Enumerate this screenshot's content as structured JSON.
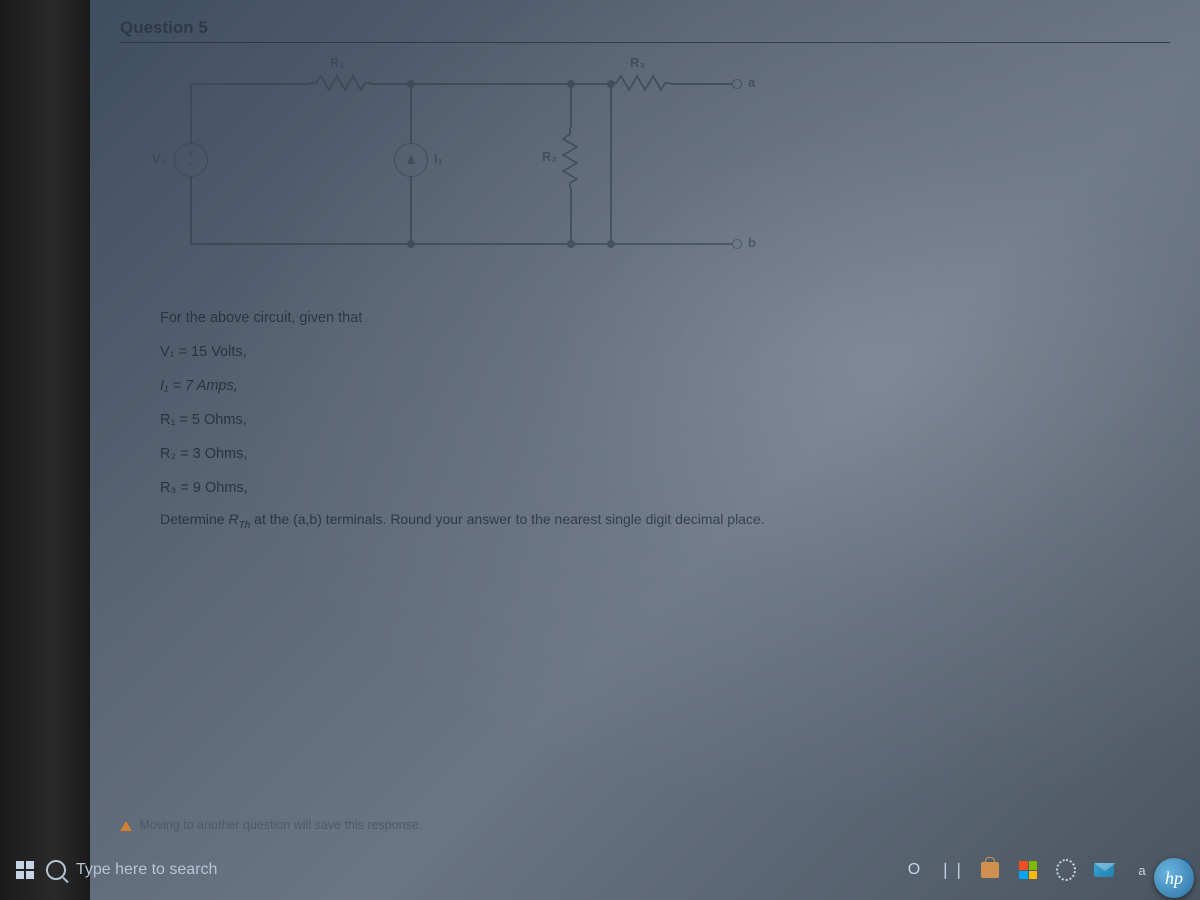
{
  "question": {
    "heading": "Question 5"
  },
  "circuit": {
    "V1": "V₁",
    "I1": "I₁",
    "R1": "R₁",
    "R2": "R₂",
    "R3": "R₃",
    "a": "a",
    "b": "b"
  },
  "given": {
    "intro": "For the above circuit, given that",
    "V1": "V₁ = 15 Volts,",
    "I1": "I₁ = 7 Amps,",
    "R1": "R₁ = 5 Ohms,",
    "R2": "R₂ = 3 Ohms,",
    "R3": "R₃ = 9 Ohms,",
    "ask_pre": "Determine ",
    "ask_var": "R",
    "ask_sub": "Th",
    "ask_post": " at the (a,b) terminals.  Round your answer to the nearest single digit decimal place."
  },
  "warning": "Moving to another question will save this response.",
  "taskbar": {
    "search_placeholder": "Type here to search",
    "cortana": "O",
    "taskview": "❘❘",
    "item_a": "a",
    "item_b": "❯"
  },
  "logo": "hp"
}
